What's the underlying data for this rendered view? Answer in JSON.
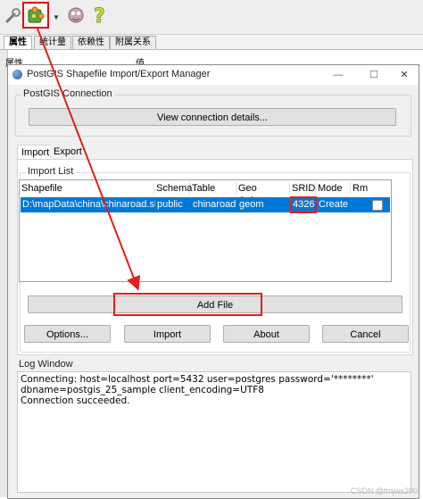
{
  "host": {
    "toolbar": {
      "icons": [
        "wrench-icon",
        "puzzle-plugin-icon",
        "dropdown-caret-icon",
        "plugin-manager-icon",
        "help-icon"
      ],
      "highlight_color": "#e0201b"
    },
    "tabs": [
      {
        "label": "属性",
        "active": true
      },
      {
        "label": "统计量",
        "active": false
      },
      {
        "label": "依赖性",
        "active": false
      },
      {
        "label": "附属关系",
        "active": false
      }
    ],
    "grid_headers": [
      "属性",
      "值"
    ]
  },
  "dialog": {
    "title": "PostGIS Shapefile Import/Export Manager",
    "controls": {
      "minimize": "—",
      "maximize": "☐",
      "close": "✕"
    },
    "connection": {
      "group_title": "PostGIS Connection",
      "view_button": "View connection details..."
    },
    "tabs": [
      {
        "label": "Import",
        "active": true
      },
      {
        "label": "Export",
        "active": false
      }
    ],
    "import_list": {
      "group_title": "Import List",
      "columns": [
        "Shapefile",
        "Schema",
        "Table",
        "Geo Column",
        "SRID",
        "Mode",
        "Rm"
      ],
      "rows": [
        {
          "shapefile": "D:\\mapData\\china\\chinaroad.shp",
          "schema": "public",
          "table": "chinaroad",
          "geo_column": "geom",
          "srid": "4326",
          "mode": "Create",
          "rm": false
        }
      ],
      "selection_color": "#0078d7",
      "add_file_button": "Add File"
    },
    "buttons": {
      "options": "Options...",
      "import": "Import",
      "about": "About",
      "cancel": "Cancel"
    },
    "log": {
      "group_title": "Log Window",
      "lines": [
        "Connecting:  host=localhost port=5432 user=postgres password='********'",
        "dbname=postgis_25_sample client_encoding=UTF8",
        "Connection succeeded."
      ]
    }
  },
  "watermark": "CSDN @fmjws200"
}
